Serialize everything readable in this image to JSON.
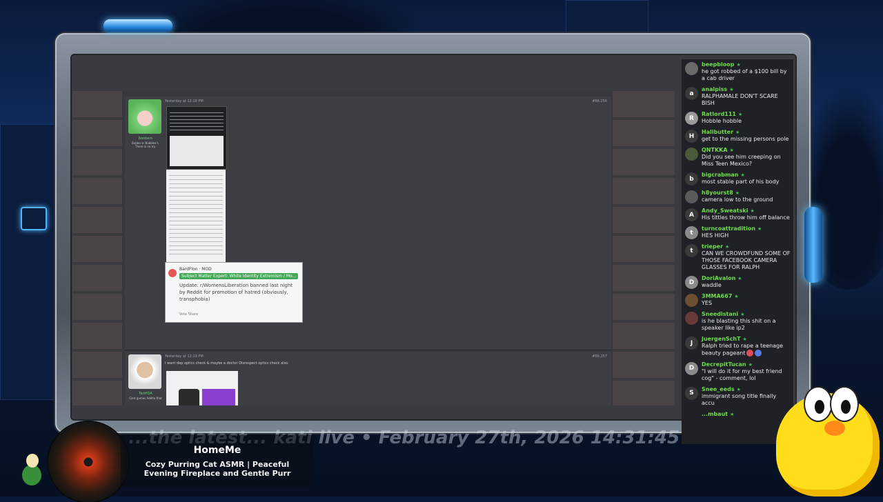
{
  "forum": {
    "post1": {
      "time": "Yesterday at 12:18 PM",
      "username": "bonbers",
      "user_title": "Bubbo or Bubbles's. There is no try.",
      "post_id": "#86,256",
      "reddit": {
        "author": "BardFlon · MOD",
        "flair": "Subject Matter Expert: White Identity Extremism / Mo...",
        "body": "Update: r/WomensLiberation banned last night by Reddit for promotion of hatred (obviously, transphobia)",
        "actions": "Vote  Share"
      }
    },
    "post2": {
      "time": "Yesterday at 12:19 PM",
      "username": "TenHDA",
      "user_title": "Cant games Addito that",
      "post_id": "#86,257",
      "text": "I want dep optics check & maybe a doctor Disrespect optics check also."
    }
  },
  "chat": {
    "messages": [
      {
        "user": "beepbloop",
        "text": "he got robbed of a $100 bill by a cab driver",
        "avatar": "",
        "color": "#6a6a6a"
      },
      {
        "user": "analpiss",
        "text": "RALPHAMALE DON'T SCARE BISH",
        "avatar": "a",
        "color": "#3a3a3a"
      },
      {
        "user": "Ratlord111",
        "text": "Hobble hobble",
        "avatar": "R",
        "color": "#9a9a9a"
      },
      {
        "user": "Halibutter",
        "text": "get to the missing persons pole",
        "avatar": "H",
        "color": "#3a3a3a"
      },
      {
        "user": "QNTKKA",
        "text": "Did you see him creeping on Miss Teen Mexico?",
        "avatar": "",
        "color": "#4a5a3a"
      },
      {
        "user": "bigcrabman",
        "text": "most stable part of his body",
        "avatar": "b",
        "color": "#3a3a3a"
      },
      {
        "user": "h8yourst8",
        "text": "camera low to the ground",
        "avatar": "",
        "color": "#5a5a5a"
      },
      {
        "user": "Andy_Sweatski",
        "text": "His titties throw him off balance",
        "avatar": "A",
        "color": "#3a3a3a"
      },
      {
        "user": "turncoattradition",
        "text": "HES HIGH",
        "avatar": "t",
        "color": "#8a8a8a"
      },
      {
        "user": "trieper",
        "text": "CAN WE CROWDFUND SOME OF THOSE FACEBOOK CAMERA GLASSES FOR RALPH",
        "avatar": "t",
        "color": "#3a3a3a"
      },
      {
        "user": "DoriAvalon",
        "text": "waddle",
        "avatar": "D",
        "color": "#8a8a8a"
      },
      {
        "user": "3MMA667",
        "text": "YES",
        "avatar": "",
        "color": "#6a5030"
      },
      {
        "user": "Sneedistani",
        "text": "is he blasting this shit on a speaker like ip2",
        "avatar": "",
        "color": "#6a3a3a"
      },
      {
        "user": "JuergenSchT",
        "text": "Ralph tried to rape a teenage beauty pageant",
        "avatar": "J",
        "color": "#3a3a3a"
      },
      {
        "user": "DecrepitTucan",
        "text": "\"I will do it for my best friend cog\" - comment, lol",
        "avatar": "D",
        "color": "#8a8a8a"
      },
      {
        "user": "Snee_eeds",
        "text": "immigrant song title finally accu",
        "avatar": "S",
        "color": "#3a3a3a"
      },
      {
        "user": "...mbaut",
        "text": "",
        "avatar": "",
        "color": "#202126"
      }
    ]
  },
  "ticker": {
    "text": "...the latest... kati live • February 27th, 2026 14:31:45"
  },
  "now_playing": {
    "title": "HomeMe",
    "subtitle": "Cozy Purring Cat ASMR | Peaceful Evening Fireplace and Gentle Purr"
  }
}
